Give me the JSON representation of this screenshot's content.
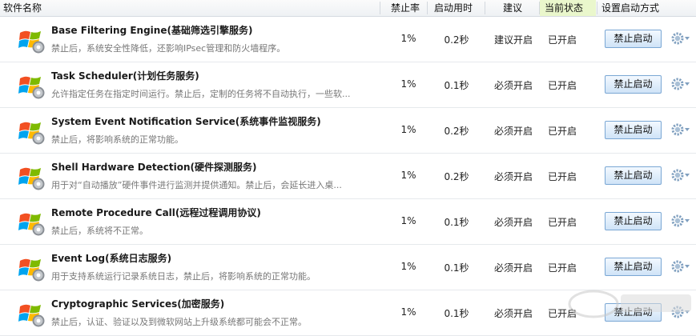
{
  "header": {
    "name": "软件名称",
    "ban_rate": "禁止率",
    "startup_time": "启动用时",
    "advice": "建议",
    "current_state": "当前状态",
    "startup_method": "设置启动方式"
  },
  "colors": {
    "accent": "#cfe3f7",
    "active_header": "#eaf7cc"
  },
  "rows": [
    {
      "title": "Base Filtering Engine(基础筛选引擎服务)",
      "desc": "禁止后，系统安全性降低，还影响IPsec管理和防火墙程序。",
      "rate": "1%",
      "time": "0.2秒",
      "advice": "建议开启",
      "state": "已开启",
      "button": "禁止启动",
      "icon": "windows-logo-gear-icon"
    },
    {
      "title": "Task Scheduler(计划任务服务)",
      "desc": "允许指定任务在指定时间运行。禁止后，定制的任务将不自动执行，一些软...",
      "rate": "1%",
      "time": "0.1秒",
      "advice": "必须开启",
      "state": "已开启",
      "button": "禁止启动",
      "icon": "windows-logo-gear-icon"
    },
    {
      "title": "System Event Notification Service(系统事件监视服务)",
      "desc": "禁止后，将影响系统的正常功能。",
      "rate": "1%",
      "time": "0.2秒",
      "advice": "必须开启",
      "state": "已开启",
      "button": "禁止启动",
      "icon": "windows-logo-gear-icon"
    },
    {
      "title": "Shell Hardware Detection(硬件探测服务)",
      "desc": "用于对“自动播放”硬件事件进行监测并提供通知。禁止后，会延长进入桌...",
      "rate": "1%",
      "time": "0.2秒",
      "advice": "必须开启",
      "state": "已开启",
      "button": "禁止启动",
      "icon": "windows-logo-gear-icon"
    },
    {
      "title": "Remote Procedure Call(远程过程调用协议)",
      "desc": "禁止后，系统将不正常。",
      "rate": "1%",
      "time": "0.1秒",
      "advice": "必须开启",
      "state": "已开启",
      "button": "禁止启动",
      "icon": "windows-logo-gear-icon"
    },
    {
      "title": "Event Log(系统日志服务)",
      "desc": "用于支持系统运行记录系统日志，禁止后，将影响系统的正常功能。",
      "rate": "1%",
      "time": "0.1秒",
      "advice": "必须开启",
      "state": "已开启",
      "button": "禁止启动",
      "icon": "windows-logo-gear-icon"
    },
    {
      "title": "Cryptographic Services(加密服务)",
      "desc": "禁止后，认证、验证以及到微软网站上升级系统都可能会不正常。",
      "rate": "1%",
      "time": "0.1秒",
      "advice": "必须开启",
      "state": "已开启",
      "button": "禁止启动",
      "icon": "windows-logo-gear-icon"
    }
  ]
}
